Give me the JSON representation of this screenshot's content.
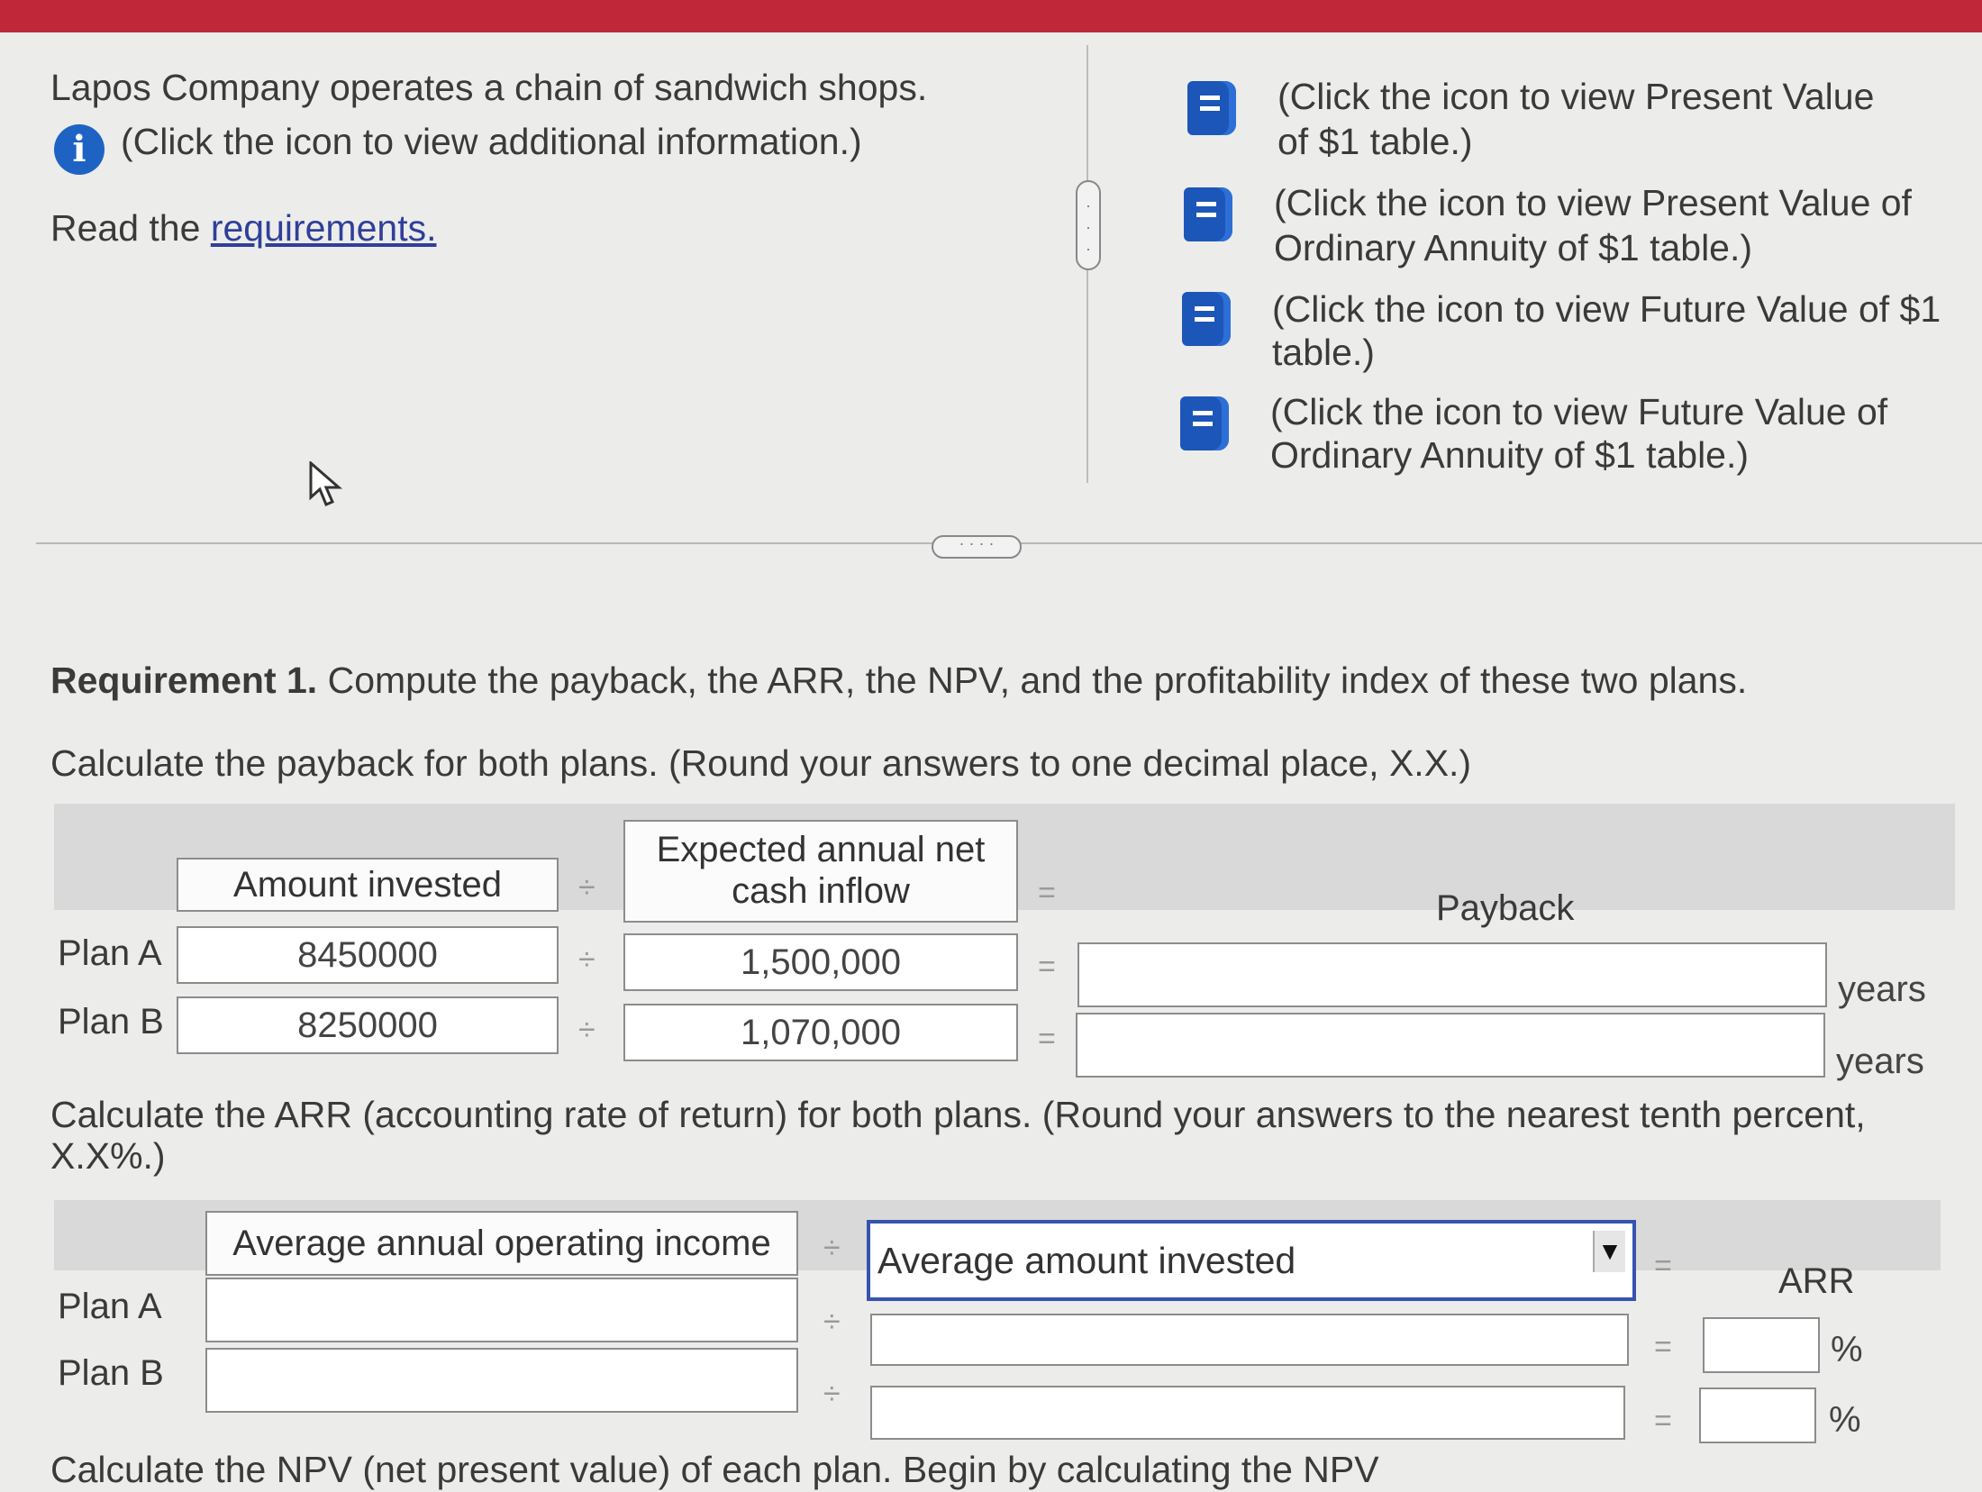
{
  "intro": {
    "company_text": "Lapos Company operates a chain of sandwich shops.",
    "info_text": "(Click the icon to view additional information.)",
    "read_prefix": "Read the",
    "requirements_link": "requirements."
  },
  "tables_links": [
    {
      "line1": "(Click the icon to view Present Value",
      "line2": "of $1 table.)",
      "icon": "book-icon"
    },
    {
      "line1": "(Click the icon to view Present Value of",
      "line2": "Ordinary Annuity of $1 table.)",
      "icon": "book-icon"
    },
    {
      "line1": "(Click the icon to view Future Value of $1",
      "line2": "table.)",
      "icon": "book-icon"
    },
    {
      "line1": "(Click the icon to view Future Value of",
      "line2": "Ordinary Annuity of $1 table.)",
      "icon": "book-icon"
    }
  ],
  "requirement": {
    "bold": "Requirement 1.",
    "text": " Compute the payback, the ARR, the NPV, and the profitability index of these two plans."
  },
  "payback": {
    "instruction": "Calculate the payback for both plans. (Round your answers to one decimal place, X.X.)",
    "col_amount": "Amount invested",
    "col_inflow_1": "Expected annual net",
    "col_inflow_2": "cash inflow",
    "col_result": "Payback",
    "divide_symbol": "÷",
    "equals_symbol": "=",
    "unit": "years",
    "rows": [
      {
        "label": "Plan A",
        "amount": "8450000",
        "inflow": "1,500,000",
        "payback": ""
      },
      {
        "label": "Plan B",
        "amount": "8250000",
        "inflow": "1,070,000",
        "payback": ""
      }
    ]
  },
  "arr": {
    "instruction_1": "Calculate the ARR (accounting rate of return) for both plans. (Round your answers to the nearest tenth percent,",
    "instruction_2": "X.X%.)",
    "col_income": "Average annual operating income",
    "col_invested_select": "Average amount invested",
    "col_result": "ARR",
    "divide_symbol": "÷",
    "equals_symbol": "=",
    "unit": "%",
    "rows": [
      {
        "label": "Plan A",
        "income": "",
        "invested": "",
        "arr": ""
      },
      {
        "label": "Plan B",
        "income": "",
        "invested": "",
        "arr": ""
      }
    ]
  },
  "npv_cutoff": "Calculate the NPV (net present value) of each plan. Begin by calculating the NPV"
}
